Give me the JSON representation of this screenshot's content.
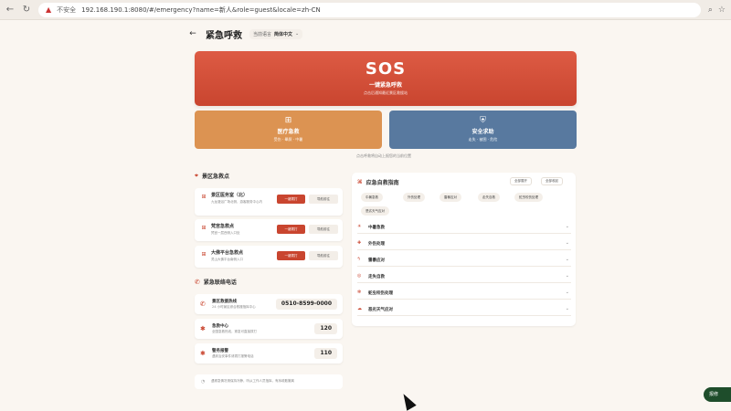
{
  "browser": {
    "insecure_label": "不安全",
    "url": "192.168.190.1:8080/#/emergency?name=新人&role=guest&locale=zh-CN"
  },
  "page": {
    "title": "紧急呼救",
    "lang_label": "当前语言",
    "lang_value": "简体中文"
  },
  "sos": {
    "label": "SOS",
    "subtitle": "一键紧急呼救",
    "desc": "点击后通知最近景区救援站"
  },
  "tiles": {
    "medical": {
      "label": "医疗急救",
      "desc": "受伤 · 晕厥 · 中暑"
    },
    "safety": {
      "label": "安全求助",
      "desc": "走失 · 被困 · 危险"
    }
  },
  "location_note": "点击呼救将自动上报您的当前位置",
  "rescue_points": {
    "title": "景区急救点",
    "call_label": "一键拨打",
    "nav_label": "导航前往",
    "items": [
      {
        "name": "景区医务室（北）",
        "addr": "九龙灌浴广场北侧，游客服务中心内"
      },
      {
        "name": "梵宫急救点",
        "addr": "梵宫一层西侧入口处"
      },
      {
        "name": "大佛平台急救点",
        "addr": "灵山大佛平台南侧入口"
      }
    ]
  },
  "contacts": {
    "title": "紧急联络电话",
    "items": [
      {
        "name": "景区救援热线",
        "desc": "24 小时景区综合救援指挥中心",
        "number": "0510-8599-0000"
      },
      {
        "name": "急救中心",
        "desc": "全国急救热线，紧急可直接拨打",
        "number": "120"
      },
      {
        "name": "警务报警",
        "desc": "遇到治安事件请拨打报警电话",
        "number": "110"
      }
    ]
  },
  "tip": "遇紧急情况请保持冷静，听从工作人员指挥，有序疏散撤离",
  "guide": {
    "title": "应急自救指南",
    "expand_all": "全部展开",
    "collapse_all": "全部收起",
    "chips": [
      "中暑急救",
      "外伤处理",
      "雷暴应对",
      "走失自救",
      "蛇虫咬伤处理",
      "恶劣天气应对"
    ],
    "sections": [
      "中暑急救",
      "外伤处理",
      "雷暴应对",
      "走失自救",
      "蛇虫咬伤处理",
      "恶劣天气应对"
    ]
  },
  "fab": {
    "label": "报修"
  },
  "colors": {
    "primary": "#c9452f",
    "medical": "#dc9352",
    "safety": "#58799f",
    "background": "#faf6f1"
  },
  "icons": {
    "back": "arrow-left-icon",
    "medical": "medical-kit-icon",
    "safety": "shield-icon",
    "location": "location-pin-icon",
    "phone": "phone-icon"
  }
}
